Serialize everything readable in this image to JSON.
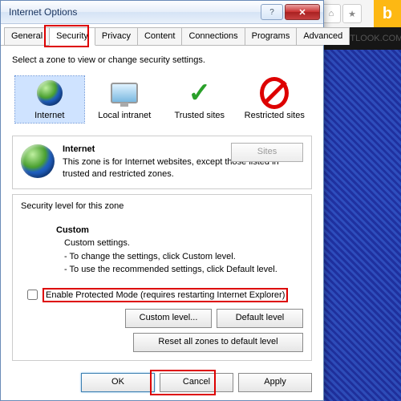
{
  "dialog": {
    "title": "Internet Options",
    "tabs": [
      "General",
      "Security",
      "Privacy",
      "Content",
      "Connections",
      "Programs",
      "Advanced"
    ],
    "active_tab": "Security",
    "zone_header": "Select a zone to view or change security settings.",
    "zones": [
      {
        "label": "Internet",
        "icon": "globe"
      },
      {
        "label": "Local intranet",
        "icon": "mon"
      },
      {
        "label": "Trusted sites",
        "icon": "check"
      },
      {
        "label": "Restricted sites",
        "icon": "forbid"
      }
    ],
    "desc": {
      "title": "Internet",
      "text": "This zone is for Internet websites, except those listed in trusted and restricted zones.",
      "sites_btn": "Sites"
    },
    "level": {
      "header": "Security level for this zone",
      "name": "Custom",
      "sub0": "Custom settings.",
      "sub1": "- To change the settings, click Custom level.",
      "sub2": "- To use the recommended settings, click Default level."
    },
    "protected_mode": "Enable Protected Mode (requires restarting Internet Explorer)",
    "btns": {
      "custom": "Custom level...",
      "default": "Default level",
      "reset": "Reset all zones to default level",
      "ok": "OK",
      "cancel": "Cancel",
      "apply": "Apply"
    }
  },
  "browser": {
    "link_text": "OUTLOOK.COM"
  }
}
